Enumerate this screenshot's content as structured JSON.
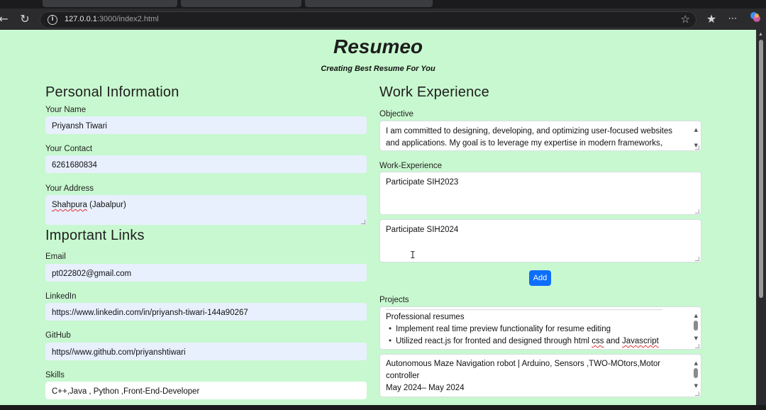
{
  "browser": {
    "url_host": "127.0.0.1",
    "url_path": ":3000/index2.html"
  },
  "page": {
    "brand": "Resumeo",
    "tagline": "Creating Best Resume For You"
  },
  "personal": {
    "heading": "Personal Information",
    "name_label": "Your Name",
    "name_value": "Priyansh Tiwari",
    "contact_label": "Your Contact",
    "contact_value": "6261680834",
    "address_label": "Your Address",
    "address_word1": "Shahpura",
    "address_rest": " (Jabalpur)"
  },
  "links": {
    "heading": "Important Links",
    "email_label": "Email",
    "email_value": "pt022802@gmail.com",
    "linkedin_label": "LinkedIn",
    "linkedin_value": " https://www.linkedin.com/in/priyansh-tiwari-144a90267",
    "github_label": "GitHub",
    "github_value": "https//www.github.com/priyanshtiwari",
    "skills_label": "Skills",
    "skills_value": "C++,Java , Python ,Front-End-Developer"
  },
  "work": {
    "heading": "Work Experience",
    "objective_label": "Objective",
    "objective_line1": "I am committed to designing, developing, and optimizing user-focused websites",
    "objective_line2": "and applications. My goal is to leverage my expertise in modern frameworks,",
    "experience_label": "Work-Experience",
    "experience_1": "Participate SIH2023",
    "experience_2": "Participate SIH2024",
    "add_button": "Add",
    "projects_label": "Projects",
    "project1_line1": "Professional resumes",
    "project1_line2": "Implement real time preview functionality for resume editing",
    "project1_line3_a": "Utilized react.js for fronted and designed through html ",
    "project1_line3_css": "css",
    "project1_line3_b": " and ",
    "project1_line3_js": "Javascript",
    "project2_line1": " Autonomous Maze Navigation robot | Arduino, Sensors ,TWO-MOtors,Motor",
    "project2_line2": "controller",
    "project2_line3": " May 2024– May 2024"
  }
}
